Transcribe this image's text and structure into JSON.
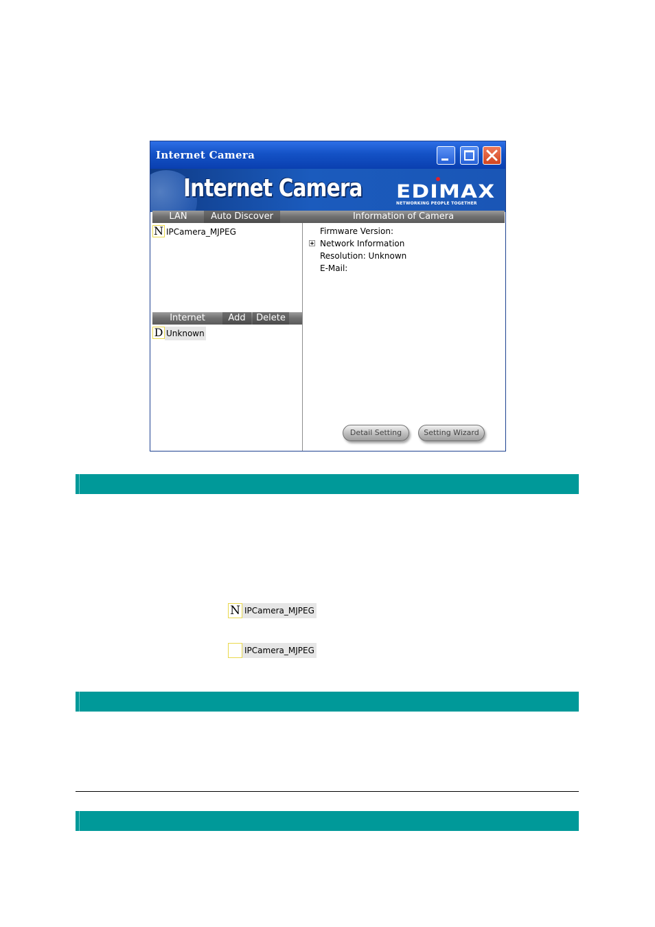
{
  "window": {
    "title": "Internet Camera",
    "banner_title": "Internet Camera",
    "brand": "EDIMAX",
    "brand_tagline": "NETWORKING PEOPLE TOGETHER"
  },
  "lan_tabs": {
    "lan_label": "LAN",
    "auto_discover_label": "Auto Discover"
  },
  "lan_list": [
    {
      "status": "N",
      "name": "IPCamera_MJPEG"
    }
  ],
  "internet_tabs": {
    "internet_label": "Internet",
    "add_label": "Add",
    "delete_label": "Delete"
  },
  "internet_list": [
    {
      "status": "D",
      "name": "Unknown"
    }
  ],
  "info": {
    "header": "Information of Camera",
    "firmware": "Firmware Version:",
    "network": "Network Information",
    "resolution": "Resolution: Unknown",
    "email": "E-Mail:"
  },
  "buttons": {
    "detail_setting": "Detail Setting",
    "setting_wizard": "Setting Wizard"
  },
  "examples": [
    {
      "status": "N",
      "name": "IPCamera_MJPEG"
    },
    {
      "status": "",
      "name": "IPCamera_MJPEG"
    }
  ],
  "colors": {
    "section_bar": "#009999",
    "titlebar": "#1452c6",
    "close_button": "#d24520"
  }
}
